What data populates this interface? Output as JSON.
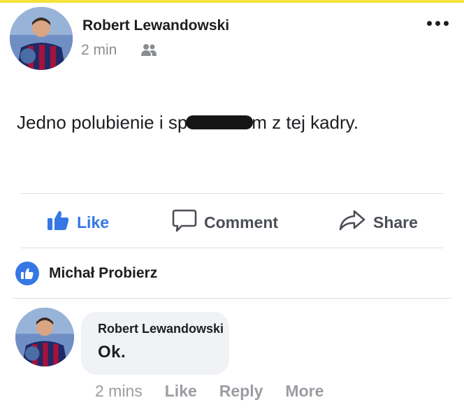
{
  "post": {
    "author": "Robert Lewandowski",
    "time": "2 min",
    "audience_icon": "friends-icon",
    "text_before": "Jedno polubienie i sp",
    "text_after": "m z tej kadry.",
    "menu_icon": "more-options-icon"
  },
  "actions": {
    "like": "Like",
    "comment": "Comment",
    "share": "Share"
  },
  "reactions": {
    "user": "Michał Probierz",
    "icon": "like-reaction-icon"
  },
  "comment": {
    "author": "Robert Lewandowski",
    "text": "Ok.",
    "time": "2 mins",
    "like": "Like",
    "reply": "Reply",
    "more": "More"
  },
  "colors": {
    "accent": "#3578e5",
    "top_bar": "#f5e23a",
    "muted": "#8a8d91"
  }
}
